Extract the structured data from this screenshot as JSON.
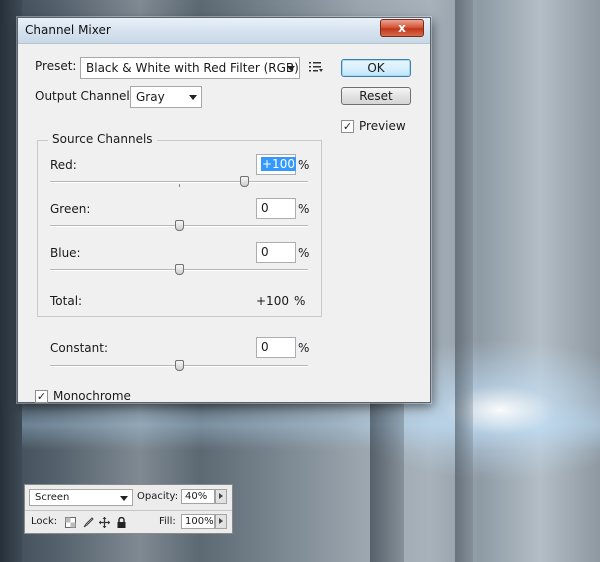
{
  "dialog": {
    "title": "Channel Mixer",
    "close_label": "x",
    "preset_label": "Preset:",
    "preset_value": "Black & White with Red Filter (RGB)",
    "output_label": "Output Channel:",
    "output_value": "Gray",
    "ok_label": "OK",
    "cancel_label": "Reset",
    "preview_label": "Preview",
    "preview_checked": true,
    "source_channels_label": "Source Channels",
    "channels": [
      {
        "label": "Red:",
        "value": "+100",
        "unit": "%",
        "slider_percent": 100
      },
      {
        "label": "Green:",
        "value": "0",
        "unit": "%",
        "slider_percent": 0
      },
      {
        "label": "Blue:",
        "value": "0",
        "unit": "%",
        "slider_percent": 0
      }
    ],
    "total_label": "Total:",
    "total_value": "+100",
    "total_unit": "%",
    "constant_label": "Constant:",
    "constant_value": "0",
    "constant_unit": "%",
    "constant_slider_percent": 0,
    "monochrome_label": "Monochrome",
    "monochrome_checked": true,
    "check_glyph": "✓"
  },
  "layers_panel": {
    "blend_mode": "Screen",
    "opacity_label": "Opacity:",
    "opacity_value": "40%",
    "lock_label": "Lock:",
    "fill_label": "Fill:",
    "fill_value": "100%"
  },
  "colors": {
    "close_red": "#c0381c",
    "selection_blue": "#3399ff",
    "ok_border": "#3c7fb1"
  }
}
